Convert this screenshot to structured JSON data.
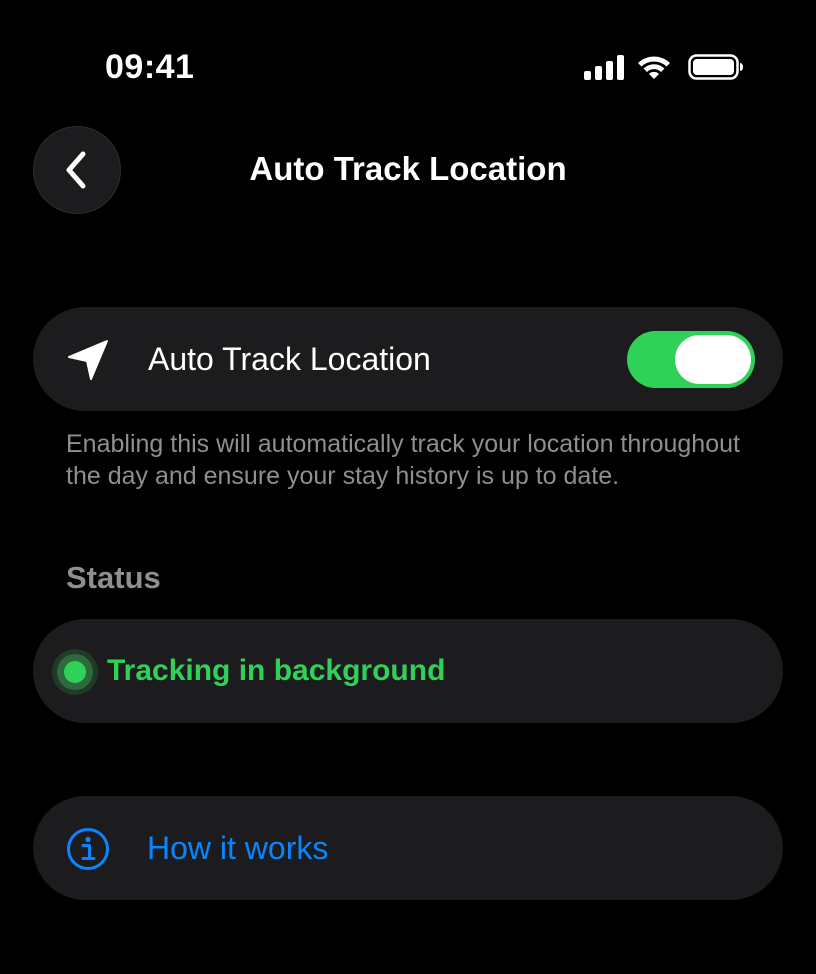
{
  "status_bar": {
    "time": "09:41",
    "icons": [
      "cellular-signal-icon",
      "wifi-icon",
      "battery-icon"
    ]
  },
  "nav": {
    "back_icon": "chevron-left-icon",
    "title": "Auto Track Location"
  },
  "toggle_row": {
    "icon": "location-arrow-icon",
    "label": "Auto Track Location",
    "enabled": true
  },
  "description": "Enabling this will automatically track your location throughout the day and ensure your stay history is up to date.",
  "status_section": {
    "label": "Status",
    "value": "Tracking in background",
    "indicator_icon": "status-dot-icon"
  },
  "how_it_works": {
    "icon": "info-circle-icon",
    "label": "How it works"
  },
  "colors": {
    "background": "#000000",
    "card": "#1c1c1e",
    "accent_green": "#30d158",
    "link_blue": "#0a84ff",
    "secondary_text": "#8e8e93"
  }
}
